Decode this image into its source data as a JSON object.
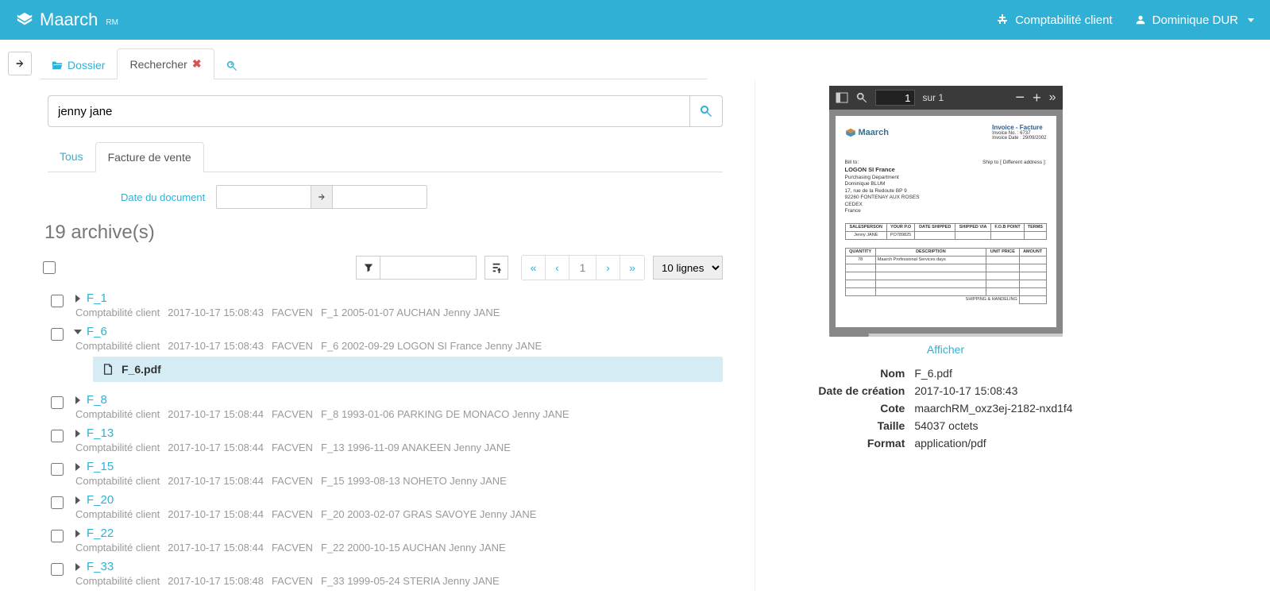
{
  "brand": {
    "name": "Maarch",
    "sub": "RM"
  },
  "top": {
    "org_label": "Comptabilité client",
    "user_label": "Dominique DUR"
  },
  "tabs": {
    "dossier": "Dossier",
    "rechercher": "Rechercher"
  },
  "search": {
    "value": "jenny jane"
  },
  "subtabs": {
    "tous": "Tous",
    "facven": "Facture de vente"
  },
  "docdate_label": "Date du document",
  "count_text": "19 archive(s)",
  "pager": {
    "current": "1"
  },
  "pagesize": "10 lignes",
  "results": [
    {
      "id": "F_1",
      "org": "Comptabilité client",
      "ts": "2017-10-17 15:08:43",
      "type": "FACVEN",
      "desc": "F_1 2005-01-07 AUCHAN Jenny JANE"
    },
    {
      "id": "F_6",
      "org": "Comptabilité client",
      "ts": "2017-10-17 15:08:43",
      "type": "FACVEN",
      "desc": "F_6 2002-09-29 LOGON SI France Jenny JANE",
      "open": true,
      "child": "F_6.pdf"
    },
    {
      "id": "F_8",
      "org": "Comptabilité client",
      "ts": "2017-10-17 15:08:44",
      "type": "FACVEN",
      "desc": "F_8 1993-01-06 PARKING DE MONACO Jenny JANE"
    },
    {
      "id": "F_13",
      "org": "Comptabilité client",
      "ts": "2017-10-17 15:08:44",
      "type": "FACVEN",
      "desc": "F_13 1996-11-09 ANAKEEN Jenny JANE"
    },
    {
      "id": "F_15",
      "org": "Comptabilité client",
      "ts": "2017-10-17 15:08:44",
      "type": "FACVEN",
      "desc": "F_15 1993-08-13 NOHETO Jenny JANE"
    },
    {
      "id": "F_20",
      "org": "Comptabilité client",
      "ts": "2017-10-17 15:08:44",
      "type": "FACVEN",
      "desc": "F_20 2003-02-07 GRAS SAVOYE Jenny JANE"
    },
    {
      "id": "F_22",
      "org": "Comptabilité client",
      "ts": "2017-10-17 15:08:44",
      "type": "FACVEN",
      "desc": "F_22 2000-10-15 AUCHAN Jenny JANE"
    },
    {
      "id": "F_33",
      "org": "Comptabilité client",
      "ts": "2017-10-17 15:08:48",
      "type": "FACVEN",
      "desc": "F_33 1999-05-24 STERIA Jenny JANE"
    }
  ],
  "preview_toolbar": {
    "page": "1",
    "of_label": "sur 1"
  },
  "invoice": {
    "logo": "Maarch",
    "title": "Invoice - Facture",
    "no": "Invoice No. : 6737",
    "date": "Invoice Date : 29/09/2002",
    "billto_h": "Bill to:",
    "shipto_h": "Ship to [ Different address ]:",
    "company": "LOGON SI France",
    "l1": "Purchasing Department",
    "l2": "Dominique BLUM",
    "l3": "17, rue de la Redoute BP 9",
    "l4": "92260 FONTENAY AUX ROSES",
    "l5": "CEDEX",
    "l6": "France",
    "h1": "SALESPERSON",
    "h2": "YOUR P.O",
    "h3": "DATE SHIPPED",
    "h4": "SHIPPED VIA",
    "h5": "F.O.B POINT",
    "h6": "TERMS",
    "r1c1": "Jenny JANE",
    "r1c2": "PO789825",
    "h7": "QUANTITY",
    "h8": "DESCRIPTION",
    "h9": "UNIT PRICE",
    "h10": "AMOUNT",
    "qty": "78",
    "item": "Maarch Professional Services days",
    "foot": "SHIPPING & HANDELING"
  },
  "afficher": "Afficher",
  "meta": {
    "k_nom": "Nom",
    "v_nom": "F_6.pdf",
    "k_date": "Date de création",
    "v_date": "2017-10-17 15:08:43",
    "k_cote": "Cote",
    "v_cote": "maarchRM_oxz3ej-2182-nxd1f4",
    "k_taille": "Taille",
    "v_taille": "54037 octets",
    "k_format": "Format",
    "v_format": "application/pdf"
  }
}
